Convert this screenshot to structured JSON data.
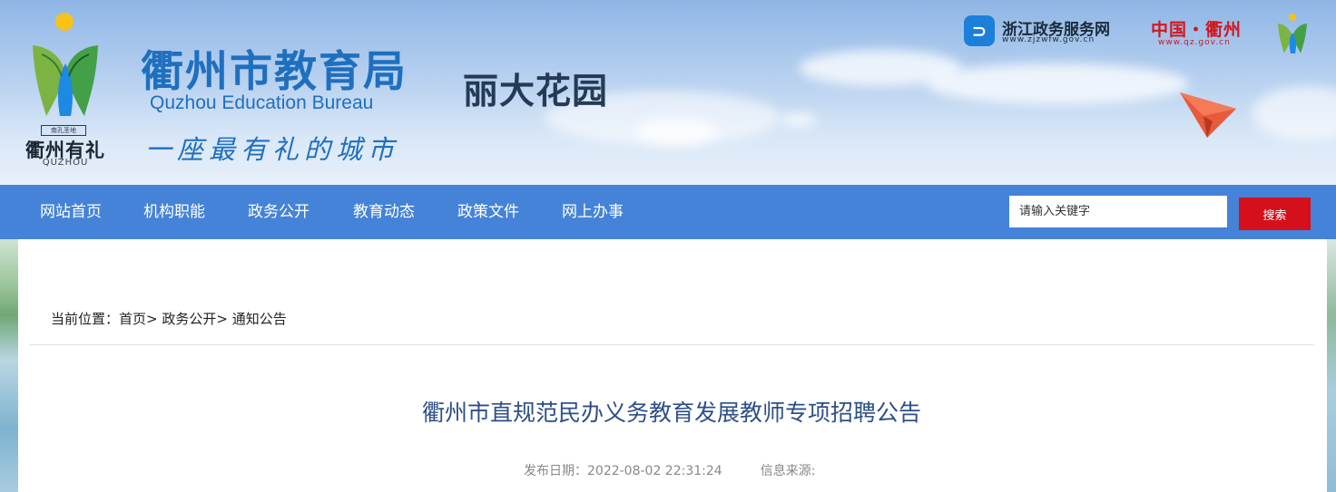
{
  "header": {
    "logo": {
      "stamp": "南孔圣地",
      "name": "衢州有礼",
      "name_en": "QUZHOU"
    },
    "title": "衢州市教育局",
    "subtitle": "Quzhou Education Bureau",
    "slogan": "一座最有礼的城市",
    "banner_phrase": "丽大花园",
    "links": {
      "zhejiang": {
        "name": "浙江政务服务网",
        "url": "www.zjzwfw.gov.cn",
        "icon": "zjzwfw-logo-icon"
      },
      "quzhou": {
        "name": "中国・衢州",
        "url": "www.qz.gov.cn"
      }
    },
    "colors": {
      "brand": "#1f6fbf",
      "sky": "#8fb6e6"
    }
  },
  "nav": {
    "items": [
      "网站首页",
      "机构职能",
      "政务公开",
      "教育动态",
      "政策文件",
      "网上办事"
    ],
    "search": {
      "placeholder": "请输入关键字",
      "button": "搜索"
    },
    "colors": {
      "bar": "#4483d8",
      "search_button": "#d5101a"
    }
  },
  "breadcrumb": {
    "prefix": "当前位置：",
    "items": [
      "首页",
      "政务公开",
      "通知公告"
    ],
    "separator": ">"
  },
  "article": {
    "title": "衢州市直规范民办义务教育发展教师专项招聘公告",
    "meta": {
      "date_label": "发布日期：",
      "date_value": "2022-08-02 22:31:24",
      "source_label": "信息来源:",
      "source_value": ""
    }
  }
}
